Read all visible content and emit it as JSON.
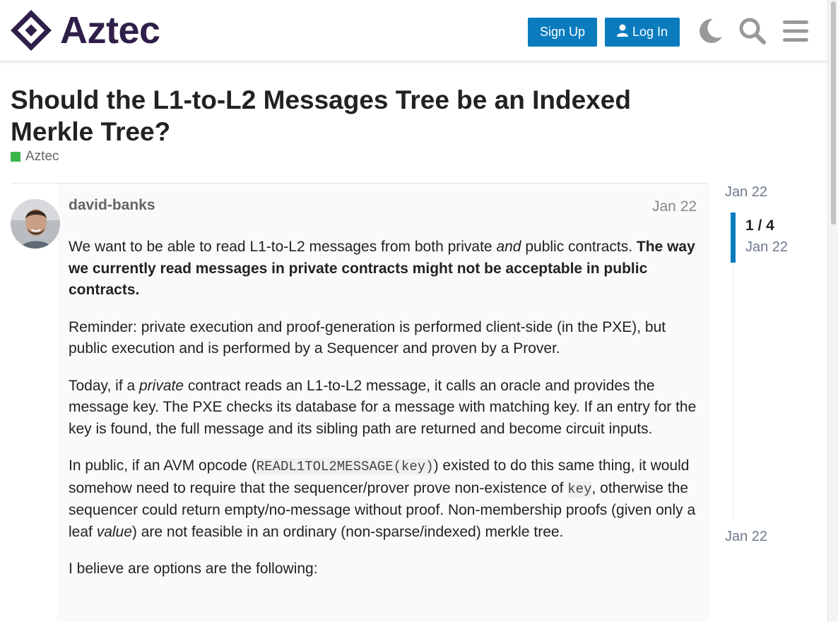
{
  "header": {
    "logo_text": "Aztec",
    "signup_label": "Sign Up",
    "login_label": "Log In",
    "brand_color": "#2f1f49",
    "accent_color": "#0a7cbe"
  },
  "topic": {
    "title": "Should the L1-to-L2 Messages Tree be an Indexed Merkle Tree?",
    "category": "Aztec",
    "category_color": "#3ab54a"
  },
  "post": {
    "username": "david-banks",
    "date": "Jan 22",
    "p1_a": "We want to be able to read L1-to-L2 messages from both private ",
    "p1_b": "and",
    "p1_c": " public contracts. ",
    "p1_d": "The way we currently read messages in private contracts might not be acceptable in public contracts.",
    "p2": "Reminder: private execution and proof-generation is performed client-side (in the PXE), but public execution and is performed by a Sequencer and proven by a Prover.",
    "p3_a": "Today, if a ",
    "p3_b": "private",
    "p3_c": " contract reads an L1-to-L2 message, it calls an oracle and provides the message key. The PXE checks its database for a message with matching key. If an entry for the key is found, the full message and its sibling path are returned and become circuit inputs.",
    "p4_a": "In public, if an AVM opcode (",
    "p4_code1": "READL1TOL2MESSAGE(key)",
    "p4_b": ") existed to do this same thing, it would somehow need to require that the sequencer/prover prove non-existence of ",
    "p4_code2": "key",
    "p4_c": ", otherwise the sequencer could return empty/no-message without proof. Non-membership proofs (given only a leaf ",
    "p4_d": "value",
    "p4_e": ") are not feasible in an ordinary (non-sparse/indexed) merkle tree.",
    "p5": "I believe are options are the following:"
  },
  "timeline": {
    "top_date": "Jan 22",
    "position": "1 / 4",
    "position_date": "Jan 22",
    "bottom_date": "Jan 22"
  },
  "icons": [
    "logo-diamond-icon",
    "user-icon",
    "moon-icon",
    "search-icon",
    "hamburger-menu-icon"
  ]
}
